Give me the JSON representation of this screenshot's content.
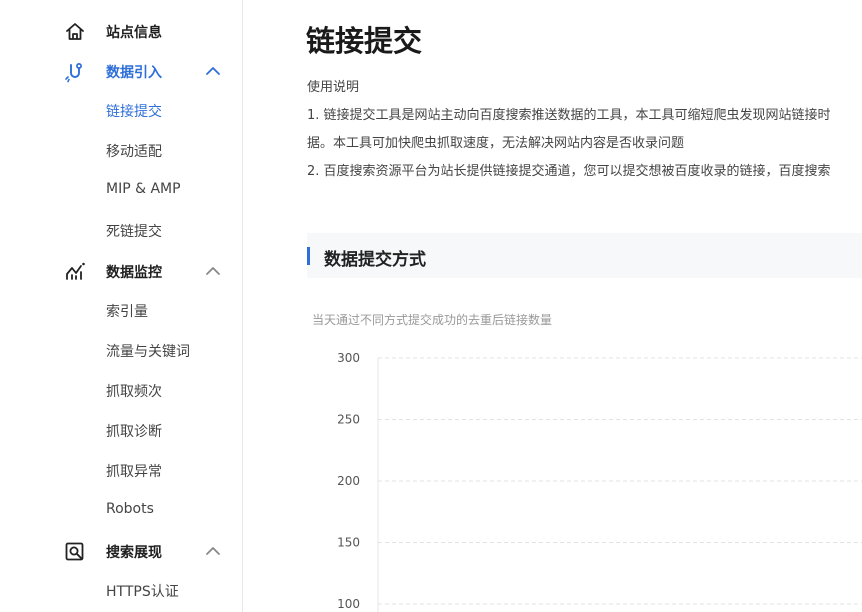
{
  "sidebar": {
    "groups": [
      {
        "label": "站点信息",
        "icon": "home-icon",
        "expanded": false,
        "items": []
      },
      {
        "label": "数据引入",
        "icon": "link-hook-icon",
        "expanded": true,
        "active": true,
        "items": [
          "链接提交",
          "移动适配",
          "MIP & AMP",
          "死链提交"
        ]
      },
      {
        "label": "数据监控",
        "icon": "chart-monitor-icon",
        "expanded": true,
        "items": [
          "索引量",
          "流量与关键词",
          "抓取频次",
          "抓取诊断",
          "抓取异常",
          "Robots"
        ]
      },
      {
        "label": "搜索展现",
        "icon": "search-display-icon",
        "expanded": true,
        "items": [
          "HTTPS认证"
        ]
      }
    ],
    "active_item": "链接提交"
  },
  "main": {
    "title": "链接提交",
    "usage_heading": "使用说明",
    "usage_lines": [
      "1. 链接提交工具是网站主动向百度搜索推送数据的工具，本工具可缩短爬虫发现网站链接时",
      "据。本工具可加快爬虫抓取速度，无法解决网站内容是否收录问题",
      "2. 百度搜索资源平台为站长提供链接提交通道，您可以提交想被百度收录的链接，百度搜索"
    ],
    "section_title": "数据提交方式",
    "chart_caption": "当天通过不同方式提交成功的去重后链接数量"
  },
  "colors": {
    "accent": "#2f6fd8",
    "text": "#333333",
    "muted": "#999999",
    "gridline": "#e3e3e3"
  },
  "chart_data": {
    "type": "line",
    "title": "",
    "xlabel": "",
    "ylabel": "",
    "ylim": [
      100,
      300
    ],
    "yticks": [
      300,
      250,
      200,
      150,
      100
    ],
    "grid": true,
    "series": []
  }
}
